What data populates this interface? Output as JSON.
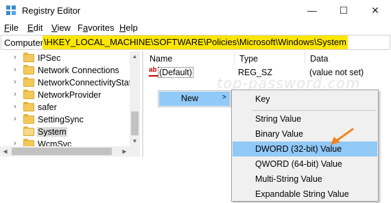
{
  "window": {
    "title": "Registry Editor",
    "buttons": {
      "minimize": "—",
      "maximize": "☐",
      "close": "✕"
    }
  },
  "menubar": [
    {
      "label": "File",
      "mnemonic": "F",
      "rest": "ile"
    },
    {
      "label": "Edit",
      "mnemonic": "E",
      "rest": "dit"
    },
    {
      "label": "View",
      "mnemonic": "V",
      "rest": "iew"
    },
    {
      "label": "Favorites",
      "mnemonic": "a",
      "pre": "F",
      "rest": "vorites"
    },
    {
      "label": "Help",
      "mnemonic": "H",
      "rest": "elp"
    }
  ],
  "address": {
    "prefix": "Computer",
    "path": "\\HKEY_LOCAL_MACHINE\\SOFTWARE\\Policies\\Microsoft\\Windows\\System",
    "highlight_color": "#ffe600"
  },
  "tree": {
    "items": [
      {
        "label": "IPSec",
        "selected": false
      },
      {
        "label": "Network Connections",
        "selected": false
      },
      {
        "label": "NetworkConnectivityStat",
        "selected": false
      },
      {
        "label": "NetworkProvider",
        "selected": false
      },
      {
        "label": "safer",
        "selected": false
      },
      {
        "label": "SettingSync",
        "selected": false
      },
      {
        "label": "System",
        "selected": true
      },
      {
        "label": "WcmSvc",
        "selected": false
      }
    ]
  },
  "list": {
    "columns": [
      "Name",
      "Type",
      "Data"
    ],
    "rows": [
      {
        "name": "(Default)",
        "type": "REG_SZ",
        "data": "(value not set)"
      }
    ]
  },
  "watermark": "top-password.com",
  "context_menu": {
    "new_label": "New",
    "submenu_arrow": ">",
    "submenu": [
      "Key",
      "String Value",
      "Binary Value",
      "DWORD (32-bit) Value",
      "QWORD (64-bit) Value",
      "Multi-String Value",
      "Expandable String Value"
    ],
    "highlighted": "DWORD (32-bit) Value",
    "highlight_color": "#91c9f7"
  },
  "annotation": {
    "arrow_color": "#f5821f"
  }
}
